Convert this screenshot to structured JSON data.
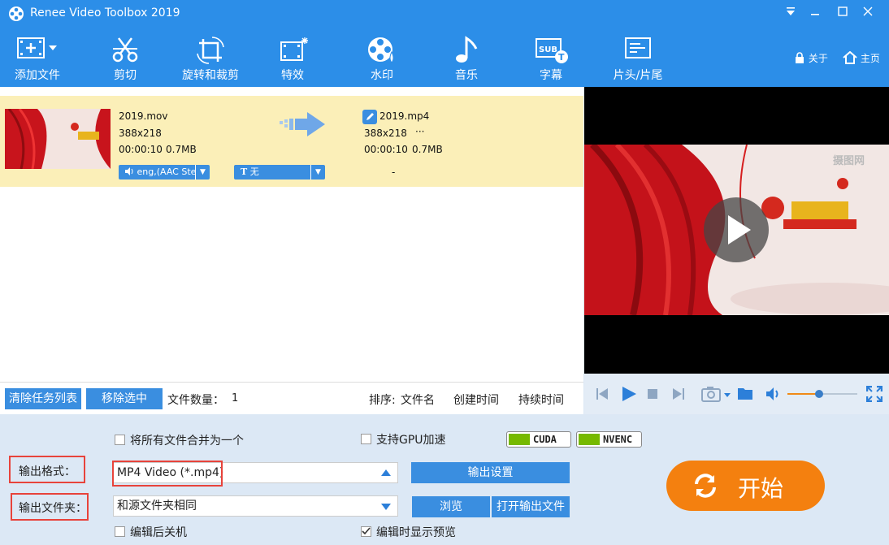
{
  "window": {
    "title": "Renee Video Toolbox 2019"
  },
  "toolbar": {
    "items": [
      {
        "label": "添加文件",
        "icon": "add-file-icon"
      },
      {
        "label": "剪切",
        "icon": "scissors-icon"
      },
      {
        "label": "旋转和裁剪",
        "icon": "rotate-crop-icon"
      },
      {
        "label": "特效",
        "icon": "effects-icon"
      },
      {
        "label": "水印",
        "icon": "watermark-icon"
      },
      {
        "label": "音乐",
        "icon": "music-icon"
      },
      {
        "label": "字幕",
        "icon": "subtitle-icon"
      },
      {
        "label": "片头/片尾",
        "icon": "intro-outro-icon"
      }
    ],
    "about": "关于",
    "home": "主页"
  },
  "task": {
    "source": {
      "name": "2019.mov",
      "resolution": "388x218",
      "duration": "00:00:10",
      "size": "0.7MB"
    },
    "output": {
      "name": "2019.mp4",
      "resolution": "388x218",
      "more": "···",
      "duration": "00:00:10",
      "size": "0.7MB"
    },
    "audio_track": "eng,(AAC Ste",
    "subtitle": "无",
    "dash": "-"
  },
  "listbar": {
    "clear": "清除任务列表",
    "remove": "移除选中",
    "count_label": "文件数量：",
    "count": "1",
    "sort_label": "排序:",
    "sort_name": "文件名",
    "sort_created": "创建时间",
    "sort_duration": "持续时间"
  },
  "preview": {
    "watermark": "摄图网"
  },
  "player": {
    "volume": 0.45
  },
  "settings": {
    "merge": "将所有文件合并为一个",
    "gpu": "支持GPU加速",
    "cuda": "CUDA",
    "nvenc": "NVENC",
    "format_label": "输出格式：",
    "format_value": "MP4 Video (*.mp4)",
    "output_settings": "输出设置",
    "folder_label": "输出文件夹：",
    "folder_value": "和源文件夹相同",
    "browse": "浏览",
    "open_output": "打开输出文件",
    "shutdown": "编辑后关机",
    "show_preview": "编辑时显示预览",
    "show_preview_checked": true,
    "start": "开始"
  }
}
